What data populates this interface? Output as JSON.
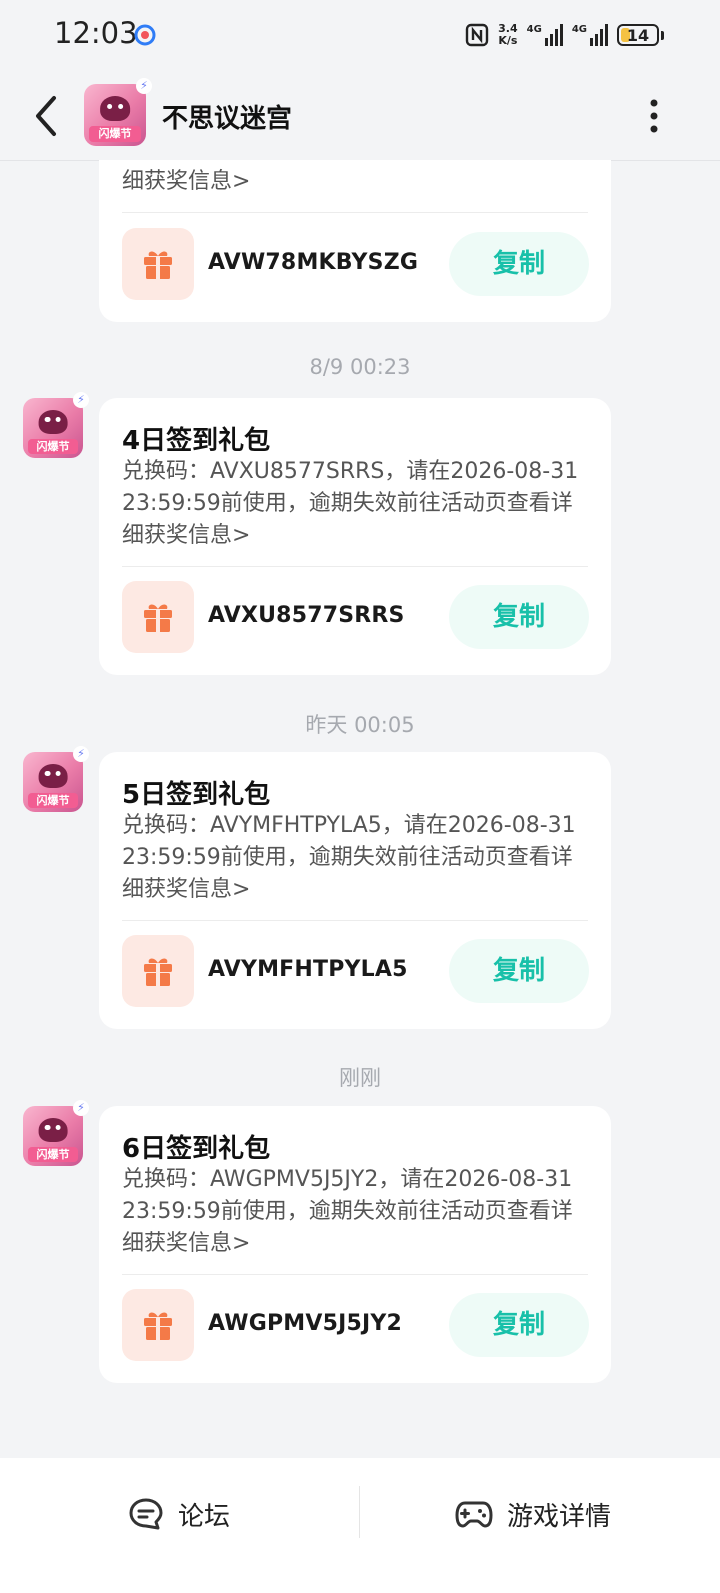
{
  "status_bar": {
    "time": "12:03",
    "net_speed_value": "3.4",
    "net_speed_unit": "K/s",
    "signal_1": "4G",
    "signal_2": "4G",
    "battery": "14"
  },
  "header": {
    "title": "不思议迷宫",
    "avatar_tag": "闪爆节"
  },
  "messages": [
    {
      "time": "",
      "desc_partial": "细获奖信息>",
      "code": "AVW78MKBYSZG",
      "copy_label": "复制"
    },
    {
      "time": "8/9  00:23",
      "title": "4日签到礼包",
      "desc": "兑换码：AVXU8577SRRS，请在2026-08-31 23:59:59前使用，逾期失效前往活动页查看详细获奖信息>",
      "code": "AVXU8577SRRS",
      "copy_label": "复制"
    },
    {
      "time": "昨天  00:05",
      "title": "5日签到礼包",
      "desc": "兑换码：AVYMFHTPYLA5，请在2026-08-31 23:59:59前使用，逾期失效前往活动页查看详细获奖信息>",
      "code": "AVYMFHTPYLA5",
      "copy_label": "复制"
    },
    {
      "time": "刚刚",
      "title": "6日签到礼包",
      "desc": "兑换码：AWGPMV5J5JY2，请在2026-08-31 23:59:59前使用，逾期失效前往活动页查看详细获奖信息>",
      "code": "AWGPMV5J5JY2",
      "copy_label": "复制"
    }
  ],
  "bottom_bar": {
    "forum_label": "论坛",
    "game_detail_label": "游戏详情"
  },
  "colors": {
    "accent_copy": "#18c0a9",
    "gift_orange": "#f47a48",
    "page_bg": "#f3f4f6"
  }
}
